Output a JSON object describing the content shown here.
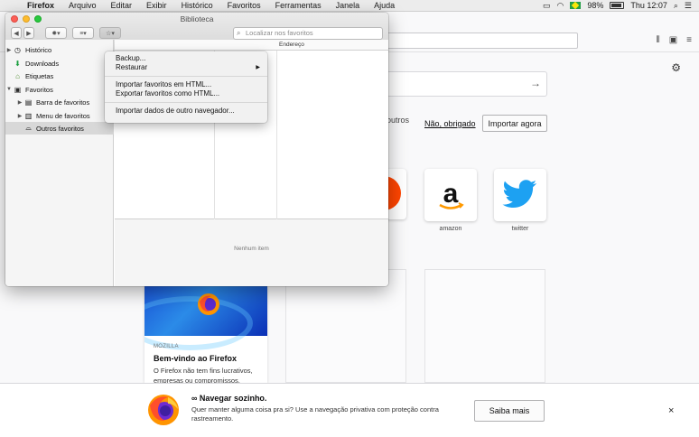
{
  "menubar": {
    "app": "Firefox",
    "items": [
      "Arquivo",
      "Editar",
      "Exibir",
      "Histórico",
      "Favoritos",
      "Ferramentas",
      "Janela",
      "Ajuda"
    ],
    "battery": "98%",
    "clock": "Thu 12:07"
  },
  "library": {
    "title": "Biblioteca",
    "search_placeholder": "Localizar nos favoritos",
    "sidebar": [
      {
        "label": "Histórico",
        "icon": "clock-icon"
      },
      {
        "label": "Downloads",
        "icon": "download-icon"
      },
      {
        "label": "Etiquetas",
        "icon": "tag-icon"
      },
      {
        "label": "Favoritos",
        "icon": "star-icon"
      },
      {
        "label": "Barra de favoritos",
        "icon": "toolbar-icon"
      },
      {
        "label": "Menu de favoritos",
        "icon": "menu-icon"
      },
      {
        "label": "Outros favoritos",
        "icon": "folder-icon"
      }
    ],
    "column_address": "Endereço",
    "empty_detail": "Nenhum item"
  },
  "import_menu": {
    "items": [
      "Backup...",
      "Restaurar",
      "Importar favoritos em HTML...",
      "Exportar favoritos como HTML...",
      "Importar dados de outro navegador..."
    ]
  },
  "newtab": {
    "partial_text": "outros",
    "no_thanks": "Não, obrigado",
    "import_now": "Importar agora",
    "tiles": [
      {
        "label": "amazon"
      },
      {
        "label": "twitter"
      }
    ],
    "card": {
      "source": "MOZILLA",
      "title": "Bem-vindo ao Firefox",
      "desc": "O Firefox não tem fins lucrativos, empresas ou compromissos."
    }
  },
  "banner": {
    "title": "∞ Navegar sozinho.",
    "desc": "Quer manter alguma coisa pra si? Use a navegação privativa com proteção contra rastreamento.",
    "button": "Saiba mais",
    "close": "×"
  }
}
